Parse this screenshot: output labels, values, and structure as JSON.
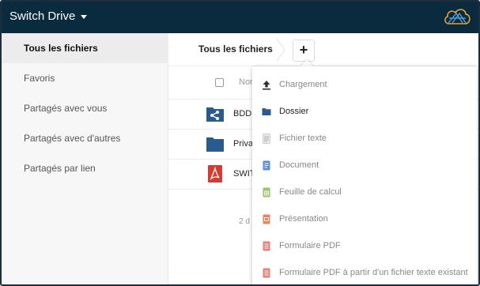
{
  "app": {
    "title": "Switch Drive"
  },
  "sidebar": {
    "items": [
      {
        "label": "Tous les fichiers",
        "active": true
      },
      {
        "label": "Favoris"
      },
      {
        "label": "Partagés avec vous"
      },
      {
        "label": "Partagés avec d'autres"
      },
      {
        "label": "Partagés par lien"
      }
    ]
  },
  "breadcrumb": {
    "label": "Tous les fichiers"
  },
  "new_button": {
    "label": "+"
  },
  "file_list": {
    "name_header": "Nor",
    "files": [
      {
        "name": "BDD",
        "icon": "shared-folder-icon"
      },
      {
        "name": "Priva",
        "icon": "folder-icon"
      },
      {
        "name": "SWIT",
        "icon": "pdf-icon"
      }
    ],
    "summary": "2 d"
  },
  "new_menu": {
    "items": [
      {
        "label": "Chargement",
        "icon": "upload-icon"
      },
      {
        "label": "Dossier",
        "icon": "folder-icon"
      },
      {
        "label": "Fichier texte",
        "icon": "text-file-icon"
      },
      {
        "label": "Document",
        "icon": "document-icon"
      },
      {
        "label": "Feuille de calcul",
        "icon": "spreadsheet-icon"
      },
      {
        "label": "Présentation",
        "icon": "presentation-icon"
      },
      {
        "label": "Formulaire PDF",
        "icon": "pdf-form-icon"
      },
      {
        "label": "Formulaire PDF à partir d'un fichier texte existant",
        "icon": "pdf-form-from-text-icon"
      }
    ]
  },
  "colors": {
    "topbar": "#0a2a3d",
    "folder": "#2a5b8f",
    "logo": "#5aa9e6",
    "pdf": "#d53c2f",
    "document": "#5b8fd6",
    "spreadsheet": "#9cc16b",
    "presentation": "#e8835b",
    "pdf_form": "#e0837d"
  }
}
